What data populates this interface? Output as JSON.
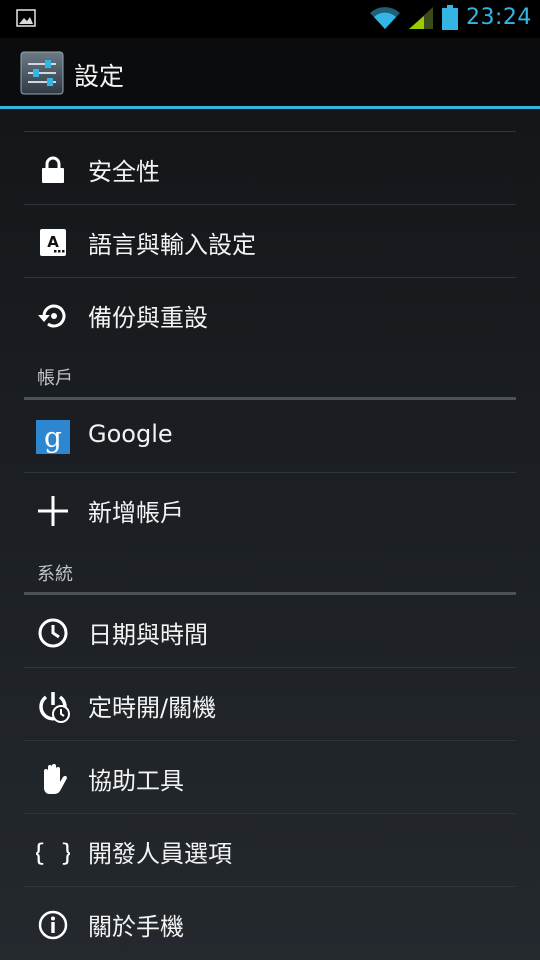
{
  "status_bar": {
    "time": "23:24",
    "icons": [
      "image-notification-icon",
      "wifi-icon",
      "signal-icon",
      "battery-icon"
    ],
    "accent_color": "#33b5e5"
  },
  "action_bar": {
    "title": "設定",
    "icon": "settings-sliders-icon"
  },
  "items_top": [
    {
      "label": "安全性",
      "icon": "lock-icon"
    },
    {
      "label": "語言與輸入設定",
      "icon": "keyboard-a-icon"
    },
    {
      "label": "備份與重設",
      "icon": "backup-restore-icon"
    }
  ],
  "sections": [
    {
      "header": "帳戶",
      "items": [
        {
          "label": "Google",
          "icon": "google-g-icon"
        },
        {
          "label": "新增帳戶",
          "icon": "plus-icon"
        }
      ]
    },
    {
      "header": "系統",
      "items": [
        {
          "label": "日期與時間",
          "icon": "clock-icon"
        },
        {
          "label": "定時開/關機",
          "icon": "power-timer-icon"
        },
        {
          "label": "協助工具",
          "icon": "hand-icon"
        },
        {
          "label": "開發人員選項",
          "icon": "braces-icon"
        },
        {
          "label": "關於手機",
          "icon": "info-icon"
        }
      ]
    }
  ]
}
